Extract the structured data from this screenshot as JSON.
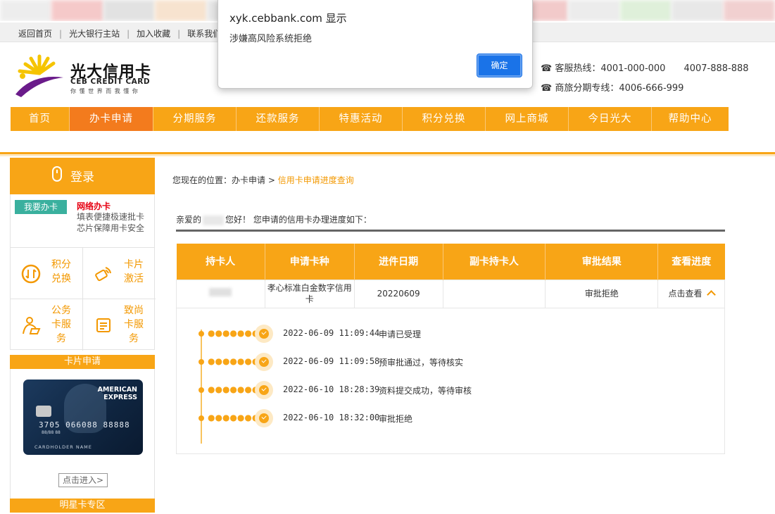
{
  "browser_dialog": {
    "title": "xyk.cebbank.com 显示",
    "message": "涉嫌高风险系统拒绝",
    "ok_label": "确定"
  },
  "top_links": [
    "返回首页",
    "光大银行主站",
    "加入收藏",
    "联系我们"
  ],
  "logo": {
    "cn": "光大信用卡",
    "en": "CEB CREDIT CARD",
    "slogan": "你 懂 世 界    而 我 懂 你"
  },
  "hotline": {
    "service_label": "客服热线：",
    "service_1": "4001-000-000",
    "service_2": "4007-888-888",
    "travel_label": "商旅分期专线：",
    "travel": "4006-666-999"
  },
  "nav": {
    "items": [
      "首页",
      "办卡申请",
      "分期服务",
      "还款服务",
      "特惠活动",
      "积分兑换",
      "网上商城",
      "今日光大",
      "帮助中心"
    ],
    "active_index": 1
  },
  "sidebar": {
    "login_label": "登录",
    "apply_button": "我要办卡",
    "apply_title": "网络办卡",
    "apply_desc_1": "填表便捷极速批卡",
    "apply_desc_2": "芯片保障用卡安全",
    "grid": [
      {
        "label": "积分兑换",
        "icon": "points-icon"
      },
      {
        "label": "卡片激活",
        "icon": "card-activate-icon"
      },
      {
        "label": "公务卡服务",
        "icon": "official-card-icon"
      },
      {
        "label": "致尚卡服务",
        "icon": "zhishang-card-icon"
      }
    ],
    "card_apply_head": "卡片申请",
    "amex": {
      "brand_1": "AMERICAN",
      "brand_2": "EXPRESS",
      "number": "3705 066088 88888",
      "small": "88/88         88",
      "holder": "CARDHOLDER NAME"
    },
    "enter_button": "点击进入>",
    "star_head": "明星卡专区"
  },
  "breadcrumb": {
    "prefix": "您现在的位置：",
    "level1": "办卡申请",
    "sep": ">",
    "current": "信用卡申请进度查询"
  },
  "greeting": {
    "before": "亲爱的",
    "after": "您好！ 您申请的信用卡办理进度如下："
  },
  "table": {
    "headers": [
      "持卡人",
      "申请卡种",
      "进件日期",
      "副卡持卡人",
      "审批结果",
      "查看进度"
    ],
    "row": {
      "card_type": "孝心标准白金数字信用卡",
      "date": "20220609",
      "secondary": "",
      "result": "审批拒绝",
      "action": "点击查看"
    }
  },
  "progress_steps": [
    {
      "time": "2022-06-09 11:09:44",
      "desc": "申请已受理"
    },
    {
      "time": "2022-06-09 11:09:58",
      "desc": "预审批通过，等待核实"
    },
    {
      "time": "2022-06-10 18:28:39",
      "desc": "资料提交成功，等待审核"
    },
    {
      "time": "2022-06-10 18:32:00",
      "desc": "审批拒绝"
    }
  ],
  "colors": {
    "brand_orange": "#f8a516",
    "active_orange": "#f37b1d",
    "reject_red": "#c00000",
    "dialog_button_blue": "#1a73e8"
  }
}
